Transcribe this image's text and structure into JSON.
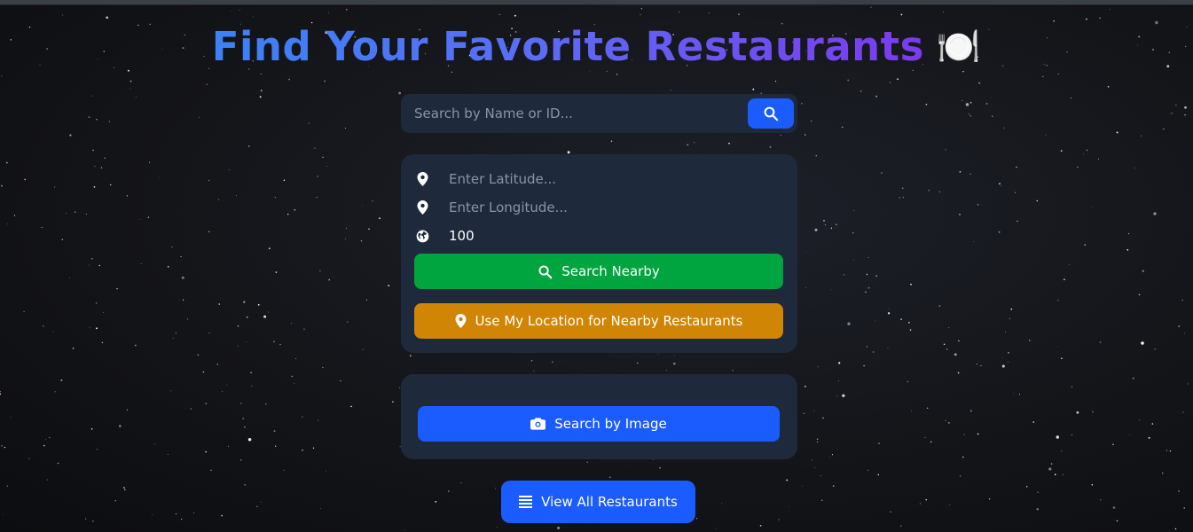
{
  "header": {
    "title": "Find Your Favorite Restaurants",
    "title_emoji": "🍽️"
  },
  "search": {
    "placeholder": "Search by Name or ID...",
    "value": "",
    "button_icon": "search-icon"
  },
  "geo": {
    "latitude_placeholder": "Enter Latitude...",
    "longitude_placeholder": "Enter Longitude...",
    "radius_value": "100",
    "search_nearby_label": "Search Nearby",
    "use_location_label": "Use My Location for Nearby Restaurants"
  },
  "image_search": {
    "label": "Search by Image"
  },
  "view_all": {
    "label": "View All Restaurants"
  },
  "colors": {
    "primary": "#1a5cff",
    "green": "#01a540",
    "orange": "#d08505",
    "card": "#1e293b",
    "title_start": "#3b82f6",
    "title_end": "#7c3aed"
  }
}
